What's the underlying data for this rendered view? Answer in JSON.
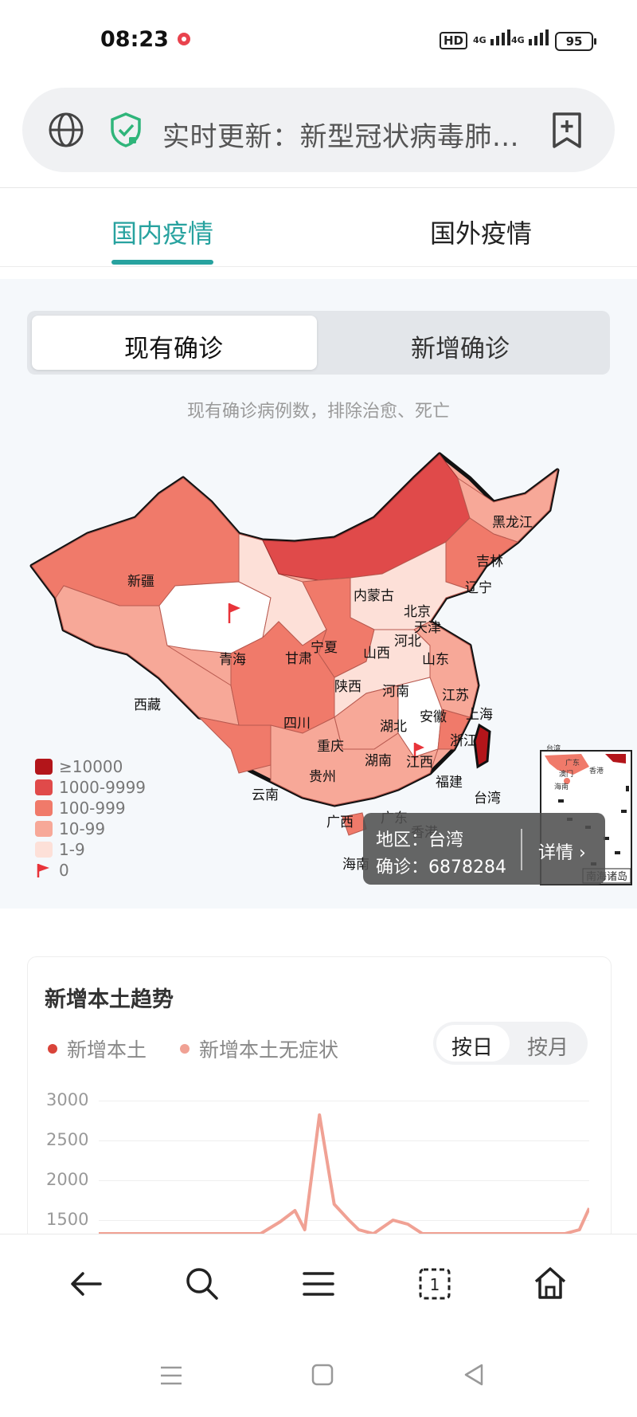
{
  "status_bar": {
    "time": "08:23",
    "hd_label": "HD",
    "signal1": "4G",
    "signal2": "4G",
    "battery": "95"
  },
  "address_bar": {
    "text": "实时更新：新型冠状病毒肺..."
  },
  "tabs": [
    {
      "label": "国内疫情",
      "active": true
    },
    {
      "label": "国外疫情",
      "active": false
    }
  ],
  "segmented": {
    "option_existing": "现有确诊",
    "option_new": "新增确诊"
  },
  "subtitle": "现有确诊病例数，排除治愈、死亡",
  "map": {
    "legend": [
      {
        "label": "≥10000",
        "color": "#b3151a"
      },
      {
        "label": "1000-9999",
        "color": "#e04a4a"
      },
      {
        "label": "100-999",
        "color": "#f07a6a"
      },
      {
        "label": "10-99",
        "color": "#f7a898"
      },
      {
        "label": "1-9",
        "color": "#fde0d8"
      },
      {
        "label": "0",
        "color": "#e8343a"
      }
    ],
    "provinces": {
      "xinjiang": "新疆",
      "xizang": "西藏",
      "qinghai": "青海",
      "gansu": "甘肃",
      "neimenggu": "内蒙古",
      "heilongjiang": "黑龙江",
      "jilin": "吉林",
      "liaoning": "辽宁",
      "beijing": "北京",
      "tianjin": "天津",
      "hebei": "河北",
      "shanxi": "山西",
      "ningxia": "宁夏",
      "shaanxi": "陕西",
      "shandong": "山东",
      "henan": "河南",
      "jiangsu": "江苏",
      "anhui": "安徽",
      "shanghai": "上海",
      "hubei": "湖北",
      "zhejiang": "浙江",
      "sichuan": "四川",
      "chongqing": "重庆",
      "hunan": "湖南",
      "jiangxi": "江西",
      "guizhou": "贵州",
      "fujian": "福建",
      "yunnan": "云南",
      "guangxi": "广西",
      "guangdong": "广东",
      "taiwan": "台湾",
      "xianggang": "香港",
      "hainan": "海南"
    },
    "inset_label": "南海诸岛",
    "inset_small": {
      "a": "台湾",
      "b": "广东",
      "c": "香港",
      "d": "澳门",
      "e": "海南"
    },
    "tooltip": {
      "region_line": "地区：台湾",
      "confirmed_line": "确诊：6878284",
      "details": "详情 ›"
    }
  },
  "trend_card": {
    "title": "新增本土趋势",
    "legend": [
      {
        "label": "新增本土",
        "color": "#d9443a"
      },
      {
        "label": "新增本土无症状",
        "color": "#f0a194"
      }
    ],
    "toggle": {
      "day": "按日",
      "month": "按月"
    }
  },
  "chart_data": {
    "type": "line",
    "title": "新增本土趋势",
    "y_ticks": [
      "3000",
      "2500",
      "2000",
      "1500"
    ],
    "ylim": [
      1200,
      3000
    ],
    "series": [
      {
        "name": "新增本土无症状",
        "color": "#f0a194",
        "points": [
          [
            0,
            1200
          ],
          [
            0.33,
            1200
          ],
          [
            0.37,
            1480
          ],
          [
            0.4,
            1620
          ],
          [
            0.42,
            1380
          ],
          [
            0.45,
            2820
          ],
          [
            0.48,
            1700
          ],
          [
            0.51,
            1500
          ],
          [
            0.53,
            1380
          ],
          [
            0.56,
            1250
          ],
          [
            0.6,
            1500
          ],
          [
            0.63,
            1450
          ],
          [
            0.66,
            1300
          ],
          [
            0.72,
            1200
          ],
          [
            0.95,
            1200
          ],
          [
            0.98,
            1380
          ],
          [
            1.0,
            1650
          ]
        ]
      }
    ]
  }
}
